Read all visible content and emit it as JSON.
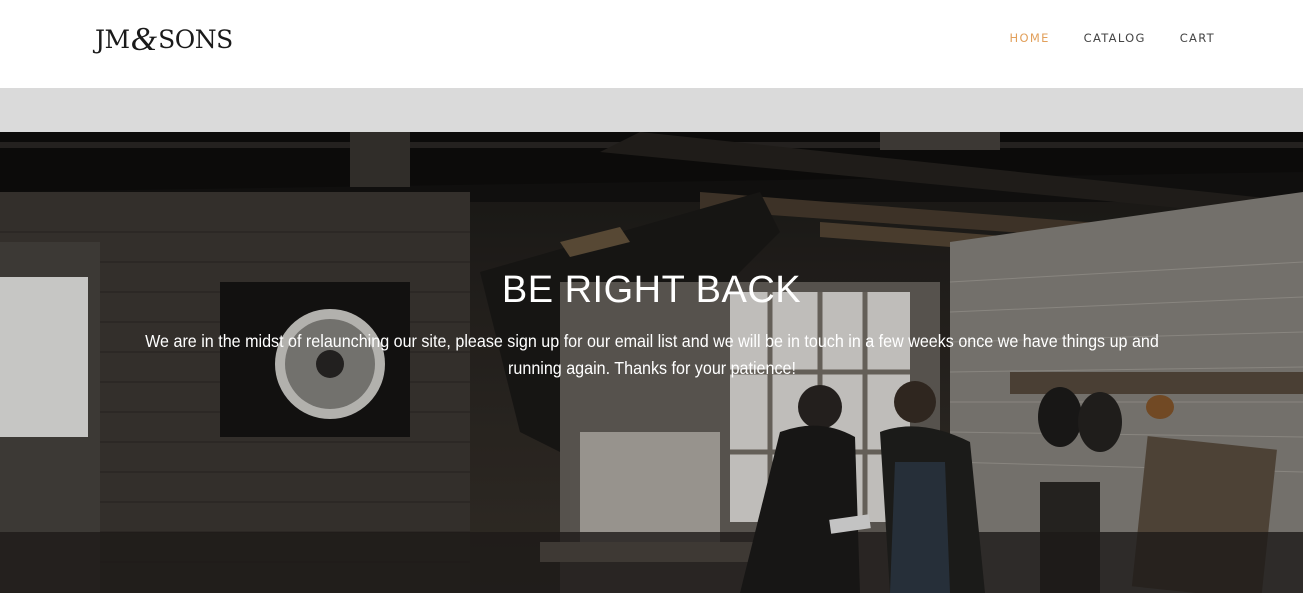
{
  "header": {
    "logo": {
      "left": "JM",
      "amp": "&",
      "right": "SONS"
    },
    "nav": [
      {
        "label": "HOME",
        "active": true
      },
      {
        "label": "CATALOG",
        "active": false
      },
      {
        "label": "CART",
        "active": false
      }
    ]
  },
  "announcement_bar": {
    "text": ""
  },
  "hero": {
    "title": "BE RIGHT BACK",
    "text": "We are in the midst of relaunching our site, please sign up for our email list and we will be in touch in a few weeks once we have things up and running again. Thanks for your patience!"
  },
  "colors": {
    "nav_active": "#e2a05b",
    "nav_default": "#444444",
    "announcement_bg": "#dadada"
  }
}
